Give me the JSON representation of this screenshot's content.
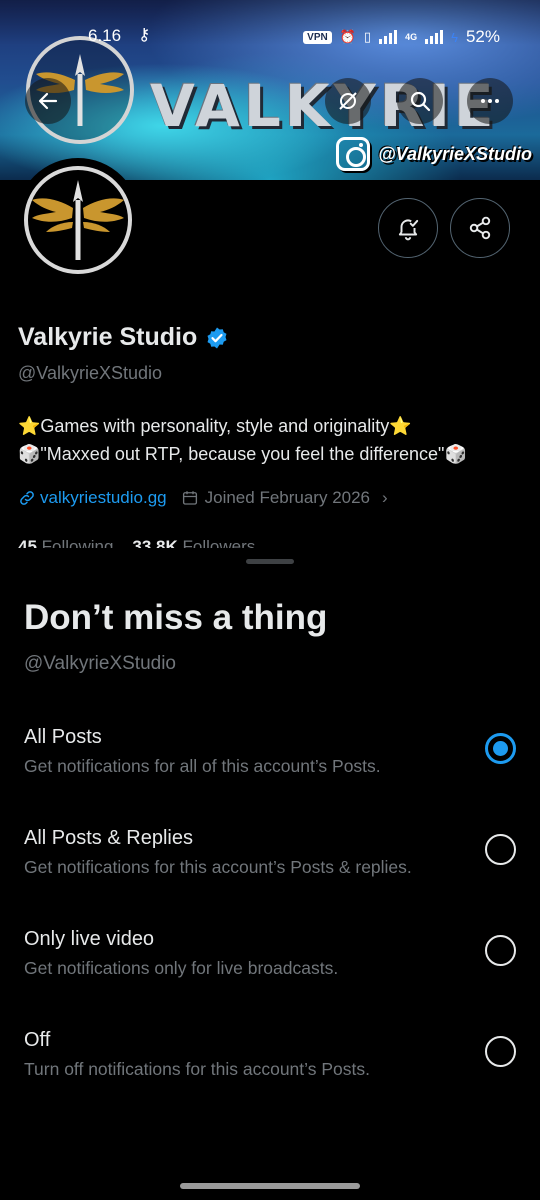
{
  "status_bar": {
    "time": "6.16",
    "vpn": "VPN",
    "network": "4G",
    "battery": "52%"
  },
  "banner": {
    "wordmark": "VALKYRIE",
    "instagram_handle": "@ValkyrieXStudio"
  },
  "profile": {
    "name": "Valkyrie Studio",
    "handle": "@ValkyrieXStudio",
    "bio_line1": "⭐Games with personality, style and originality⭐",
    "bio_line2": "🎲\"Maxxed out RTP, because you feel the difference\"🎲",
    "website": "valkyriestudio.gg",
    "joined": "Joined February 2026",
    "following_count": "45",
    "following_label": "Following",
    "followers_count": "33.8K",
    "followers_label": "Followers"
  },
  "sheet": {
    "title": "Don’t miss a thing",
    "subtitle": "@ValkyrieXStudio",
    "options": [
      {
        "label": "All Posts",
        "description": "Get notifications for all of this account’s Posts.",
        "selected": true
      },
      {
        "label": "All Posts & Replies",
        "description": "Get notifications for this account’s Posts & replies.",
        "selected": false
      },
      {
        "label": "Only live video",
        "description": "Get notifications only for live broadcasts.",
        "selected": false
      },
      {
        "label": "Off",
        "description": "Turn off notifications for this account’s Posts.",
        "selected": false
      }
    ]
  },
  "colors": {
    "accent": "#1d9bf0",
    "secondary_text": "#71767b",
    "gold": "#c9962e"
  }
}
